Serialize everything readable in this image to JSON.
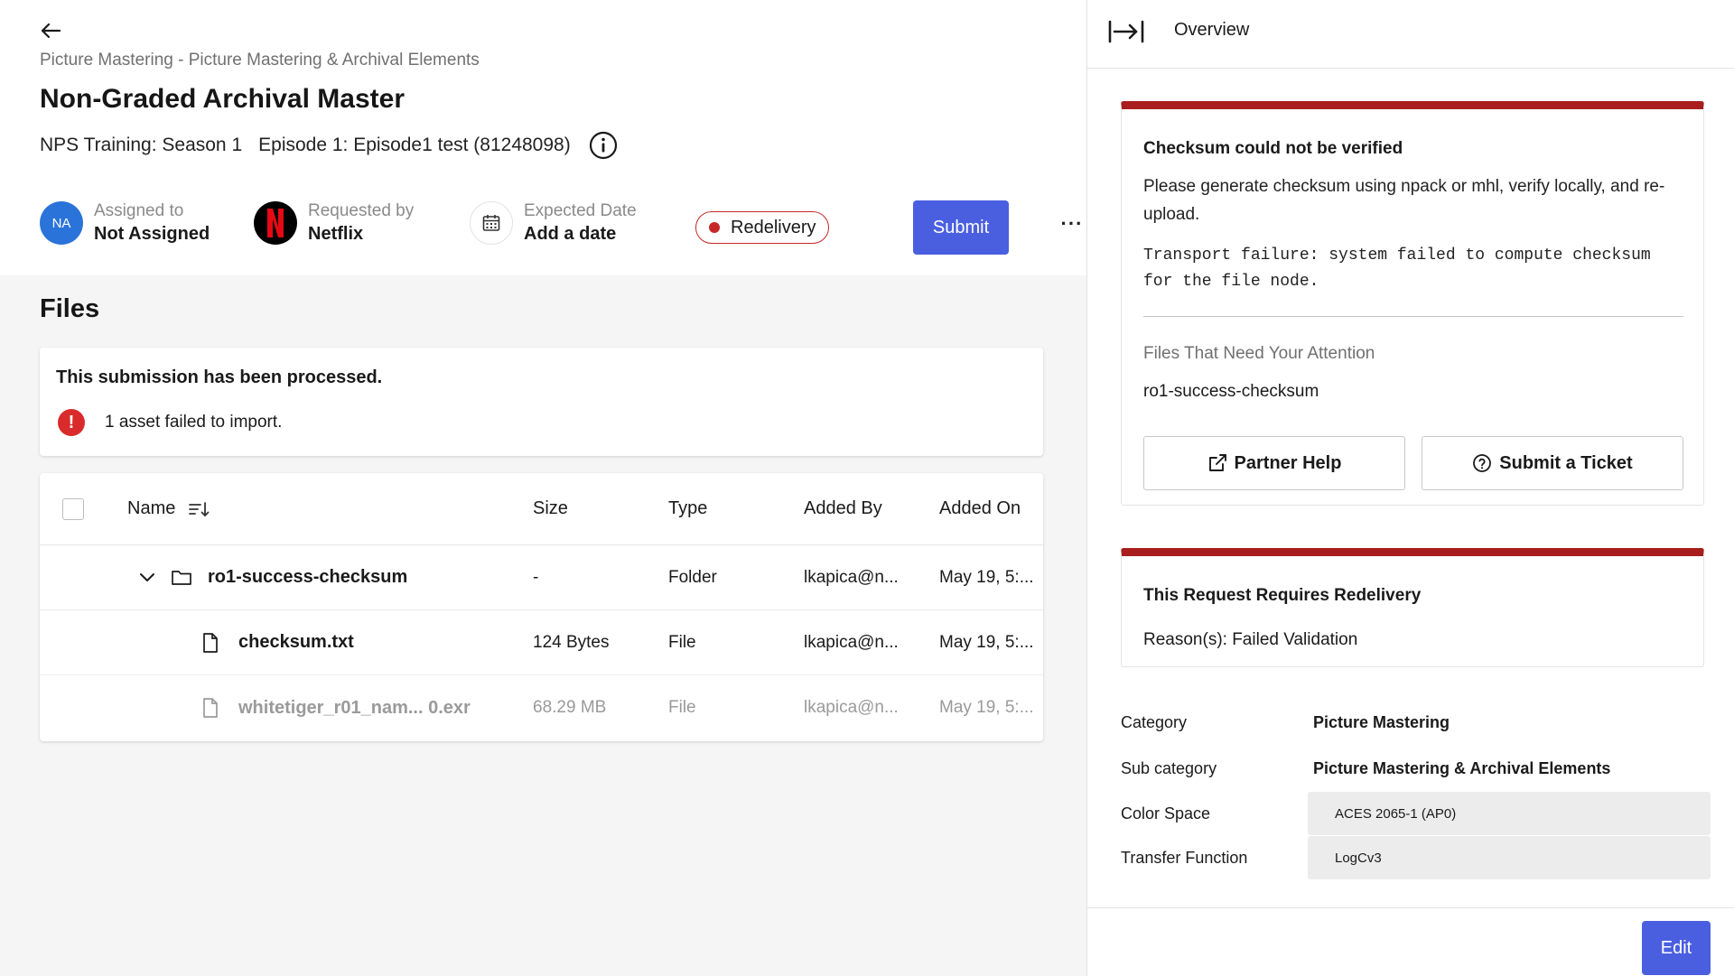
{
  "header": {
    "breadcrumb": "Picture Mastering - Picture Mastering & Archival Elements",
    "title": "Non-Graded Archival Master",
    "season": "NPS Training: Season 1",
    "episode": "Episode 1: Episode1 test (81248098)",
    "assigned_label": "Assigned to",
    "assigned_value": "Not Assigned",
    "assigned_initials": "NA",
    "requested_label": "Requested by",
    "requested_value": "Netflix",
    "requested_logo": "N",
    "date_label": "Expected Date",
    "date_value": "Add a date",
    "status_pill": "Redelivery",
    "submit_label": "Submit",
    "more_label": "···"
  },
  "files": {
    "title": "Files",
    "processed_title": "This submission has been processed.",
    "error_message": "1 asset failed to import.",
    "error_icon": "!",
    "columns": {
      "name": "Name",
      "size": "Size",
      "type": "Type",
      "added_by": "Added By",
      "added_on": "Added On"
    },
    "rows": [
      {
        "name": "ro1-success-checksum",
        "size": "-",
        "type": "Folder",
        "added_by": "lkapica@n...",
        "added_on": "May 19, 5:..."
      },
      {
        "name": "checksum.txt",
        "size": "124 Bytes",
        "type": "File",
        "added_by": "lkapica@n...",
        "added_on": "May 19, 5:..."
      },
      {
        "name": "whitetiger_r01_nam... 0.exr",
        "size": "68.29 MB",
        "type": "File",
        "added_by": "lkapica@n...",
        "added_on": "May 19, 5:..."
      }
    ]
  },
  "panel": {
    "title": "Overview",
    "alert1": {
      "title": "Checksum could not be verified",
      "body": "Please generate checksum using npack or mhl, verify locally, and re-upload.",
      "detail": "Transport failure: system failed to compute checksum for the file node.",
      "attention_label": "Files That Need Your Attention",
      "attention_file": "ro1-success-checksum",
      "partner_help": "Partner Help",
      "submit_ticket": "Submit a Ticket"
    },
    "alert2": {
      "title": "This Request Requires Redelivery",
      "reason": "Reason(s): Failed Validation"
    },
    "properties": {
      "category_label": "Category",
      "category_value": "Picture Mastering",
      "subcategory_label": "Sub category",
      "subcategory_value": "Picture Mastering & Archival Elements",
      "colorspace_label": "Color Space",
      "colorspace_value": "ACES 2065-1 (AP0)",
      "transfer_label": "Transfer Function",
      "transfer_value": "LogCv3"
    },
    "edit_label": "Edit"
  },
  "colors": {
    "accent": "#4a5fe0",
    "alert_red": "#a81d1d",
    "error_red": "#d92b2b",
    "avatar_blue": "#2a73d9",
    "netflix_red": "#e50914"
  },
  "icons": [
    "back-arrow-icon",
    "info-icon",
    "calendar-icon",
    "sort-icon",
    "chevron-down-icon",
    "folder-icon",
    "file-icon",
    "collapse-panel-icon",
    "external-link-icon",
    "help-circle-icon",
    "error-icon",
    "netflix-logo"
  ]
}
